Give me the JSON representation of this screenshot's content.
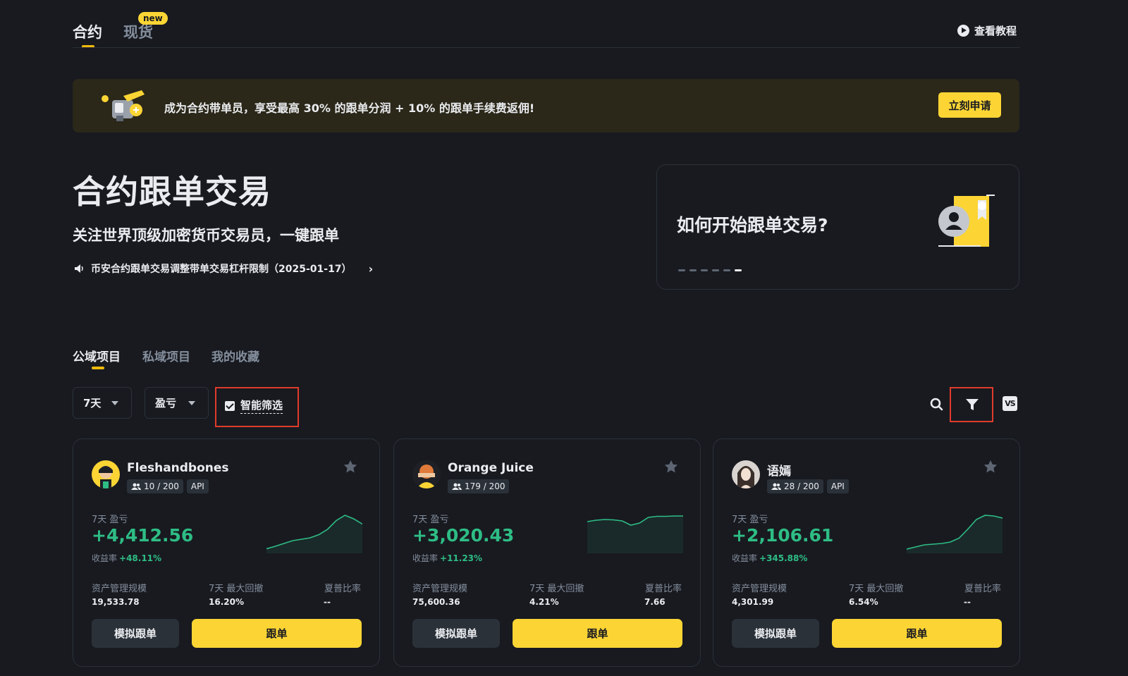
{
  "top_tabs": [
    {
      "label": "合约",
      "active": true
    },
    {
      "label": "现货",
      "active": false,
      "badge": "new"
    }
  ],
  "tutorial": {
    "label": "查看教程",
    "icon": "play-circle-icon"
  },
  "banner": {
    "text": "成为合约带单员，享受最高 30% 的跟单分润 + 10% 的跟单手续费返佣!",
    "button": "立刻申请"
  },
  "hero": {
    "title": "合约跟单交易",
    "subtitle": "关注世界顶级加密货币交易员，一键跟单",
    "notice": "币安合约跟单交易调整带单交易杠杆限制（2025-01-17）"
  },
  "how_card": {
    "title": "如何开始跟单交易?",
    "slides": 6,
    "active_slide": 6
  },
  "section_tabs": [
    {
      "label": "公域项目",
      "active": true
    },
    {
      "label": "私域项目",
      "active": false
    },
    {
      "label": "我的收藏",
      "active": false
    }
  ],
  "filters": {
    "period": "7天",
    "sort": "盈亏",
    "smart_filter": {
      "label": "智能筛选",
      "checked": true
    }
  },
  "colors": {
    "background": "#181a20",
    "accent": "#fcd535",
    "profit": "#2ebd85",
    "muted": "#848e9c",
    "highlight_box": "#e03b2a"
  },
  "cards": [
    {
      "name": "Fleshandbones",
      "followers": "10 / 200",
      "tag": "API",
      "pnl_label": "7天 盈亏",
      "pnl": "+4,412.56",
      "roi_label": "收益率",
      "roi": "+48.11%",
      "stats": [
        {
          "label": "资产管理规模",
          "value": "19,533.78"
        },
        {
          "label": "7天 最大回撤",
          "value": "16.20%"
        },
        {
          "label": "夏普比率",
          "value": "--"
        }
      ],
      "buttons": {
        "mock": "模拟跟单",
        "copy": "跟单"
      },
      "trend": [
        0.05,
        0.12,
        0.2,
        0.28,
        0.32,
        0.36,
        0.45,
        0.6,
        0.85,
        1.0,
        0.9,
        0.75
      ]
    },
    {
      "name": "Orange Juice",
      "followers": "179 / 200",
      "tag": "",
      "pnl_label": "7天 盈亏",
      "pnl": "+3,020.43",
      "roi_label": "收益率",
      "roi": "+11.23%",
      "stats": [
        {
          "label": "资产管理规模",
          "value": "75,600.36"
        },
        {
          "label": "7天 最大回撤",
          "value": "4.21%"
        },
        {
          "label": "夏普比率",
          "value": "7.66"
        }
      ],
      "buttons": {
        "mock": "模拟跟单",
        "copy": "跟单"
      },
      "trend": [
        0.82,
        0.86,
        0.88,
        0.87,
        0.84,
        0.72,
        0.78,
        0.94,
        0.97,
        0.97,
        0.98,
        0.98
      ]
    },
    {
      "name": "语嫣",
      "followers": "28 / 200",
      "tag": "API",
      "pnl_label": "7天 盈亏",
      "pnl": "+2,106.61",
      "roi_label": "收益率",
      "roi": "+345.88%",
      "stats": [
        {
          "label": "资产管理规模",
          "value": "4,301.99"
        },
        {
          "label": "7天 最大回撤",
          "value": "6.54%"
        },
        {
          "label": "夏普比率",
          "value": "--"
        }
      ],
      "buttons": {
        "mock": "模拟跟单",
        "copy": "跟单"
      },
      "trend": [
        0.04,
        0.1,
        0.16,
        0.18,
        0.2,
        0.24,
        0.35,
        0.6,
        0.88,
        1.0,
        0.98,
        0.92
      ]
    }
  ]
}
